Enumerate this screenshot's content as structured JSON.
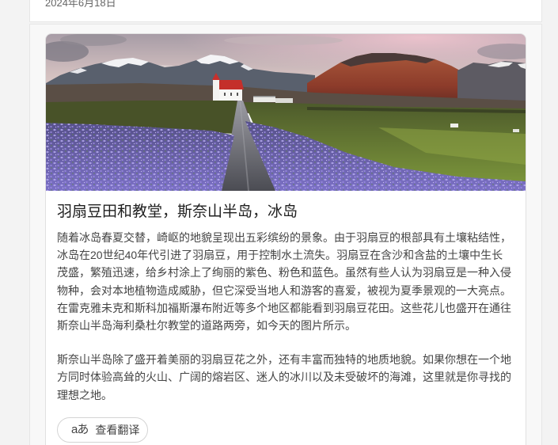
{
  "colors": {
    "page_bg": "#f3f3f3",
    "card_bg": "#ffffff",
    "title": "#1f1f1f",
    "body_text": "#444444",
    "button_border": "#d4d4d4"
  },
  "date_card": {
    "date": "2024年6月18日"
  },
  "article": {
    "title": "羽扇豆田和教堂，斯奈山半岛，冰岛",
    "paragraphs": [
      "随着冰岛春夏交替，崎岖的地貌呈现出五彩缤纷的景象。由于羽扇豆的根部具有土壤粘结性，冰岛在20世纪40年代引进了羽扇豆，用于控制水土流失。羽扇豆在含沙和含盐的土壤中生长茂盛，繁殖迅速，给乡村涂上了绚丽的紫色、粉色和蓝色。虽然有些人认为羽扇豆是一种入侵物种，会对本地植物造成威胁，但它深受当地人和游客的喜爱，被视为夏季景观的一大亮点。在雷克雅未克和斯科加福斯瀑布附近等多个地区都能看到羽扇豆花田。这些花儿也盛开在通往斯奈山半岛海利桑杜尔教堂的道路两旁，如今天的图片所示。",
      "斯奈山半岛除了盛开着美丽的羽扇豆花之外，还有丰富而独特的地质地貌。如果你想在一个地方同时体验高耸的火山、广阔的熔岩区、迷人的冰川以及未受破坏的海滩，这里就是你寻找的理想之地。"
    ],
    "translate_button": {
      "icon": "translate-icon",
      "icon_glyph": "aあ",
      "label": "查看翻译"
    }
  }
}
